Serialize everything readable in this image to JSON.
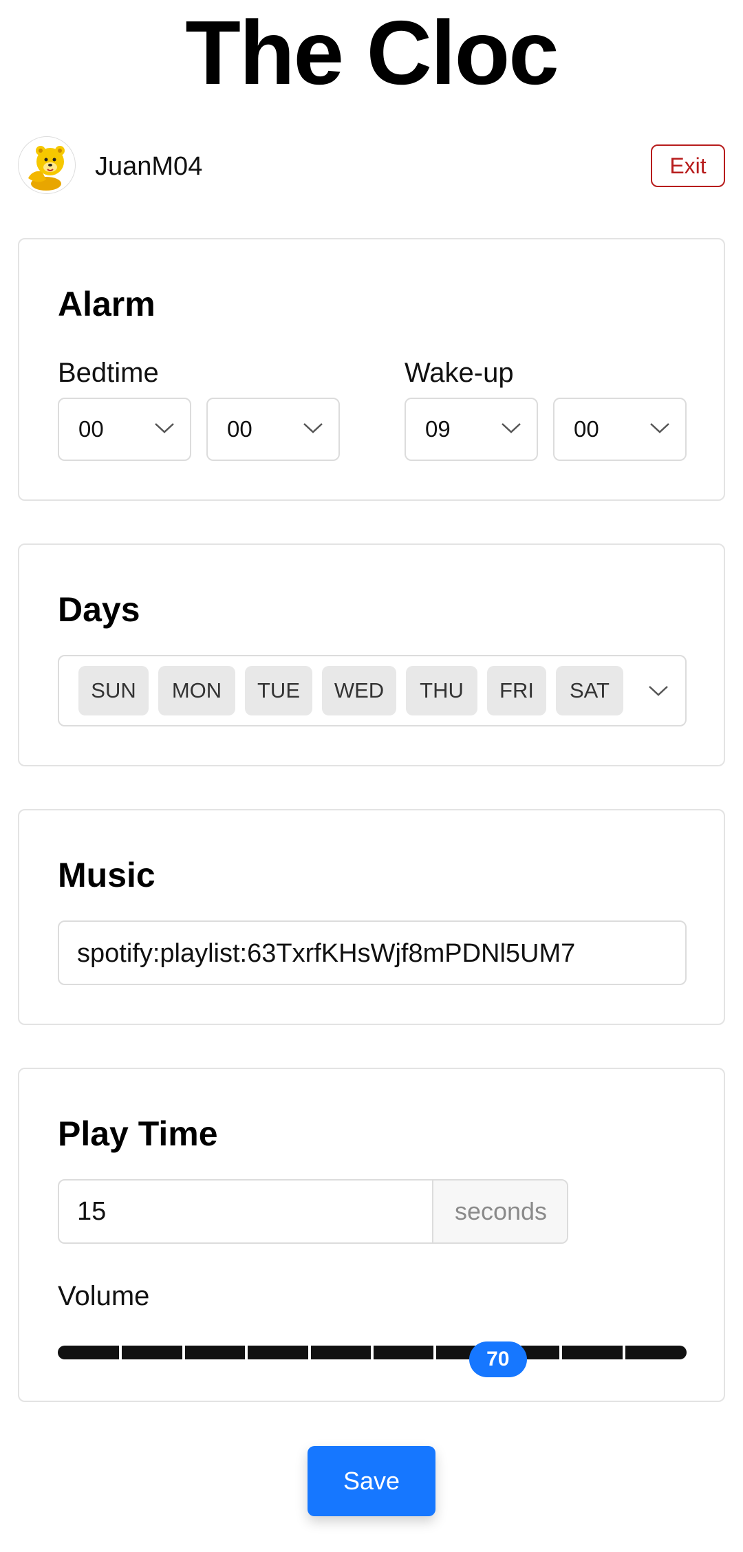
{
  "app": {
    "title": "The Cloc"
  },
  "user": {
    "name": "JuanM04",
    "avatar_icon": "bear-avatar-icon",
    "exit_label": "Exit"
  },
  "alarm": {
    "title": "Alarm",
    "bedtime": {
      "label": "Bedtime",
      "hour": "00",
      "minute": "00"
    },
    "wakeup": {
      "label": "Wake-up",
      "hour": "09",
      "minute": "00"
    }
  },
  "days": {
    "title": "Days",
    "items": [
      "SUN",
      "MON",
      "TUE",
      "WED",
      "THU",
      "FRI",
      "SAT"
    ]
  },
  "music": {
    "title": "Music",
    "value": "spotify:playlist:63TxrfKHsWjf8mPDNl5UM7"
  },
  "playtime": {
    "title": "Play Time",
    "value": "15",
    "unit": "seconds",
    "volume_label": "Volume",
    "volume_value": "70",
    "volume_max": 100,
    "volume_steps": 10
  },
  "actions": {
    "save_label": "Save"
  },
  "colors": {
    "primary": "#1677ff",
    "danger": "#b71c1c",
    "border": "#dcdcdc",
    "chip": "#e8e8e8"
  }
}
